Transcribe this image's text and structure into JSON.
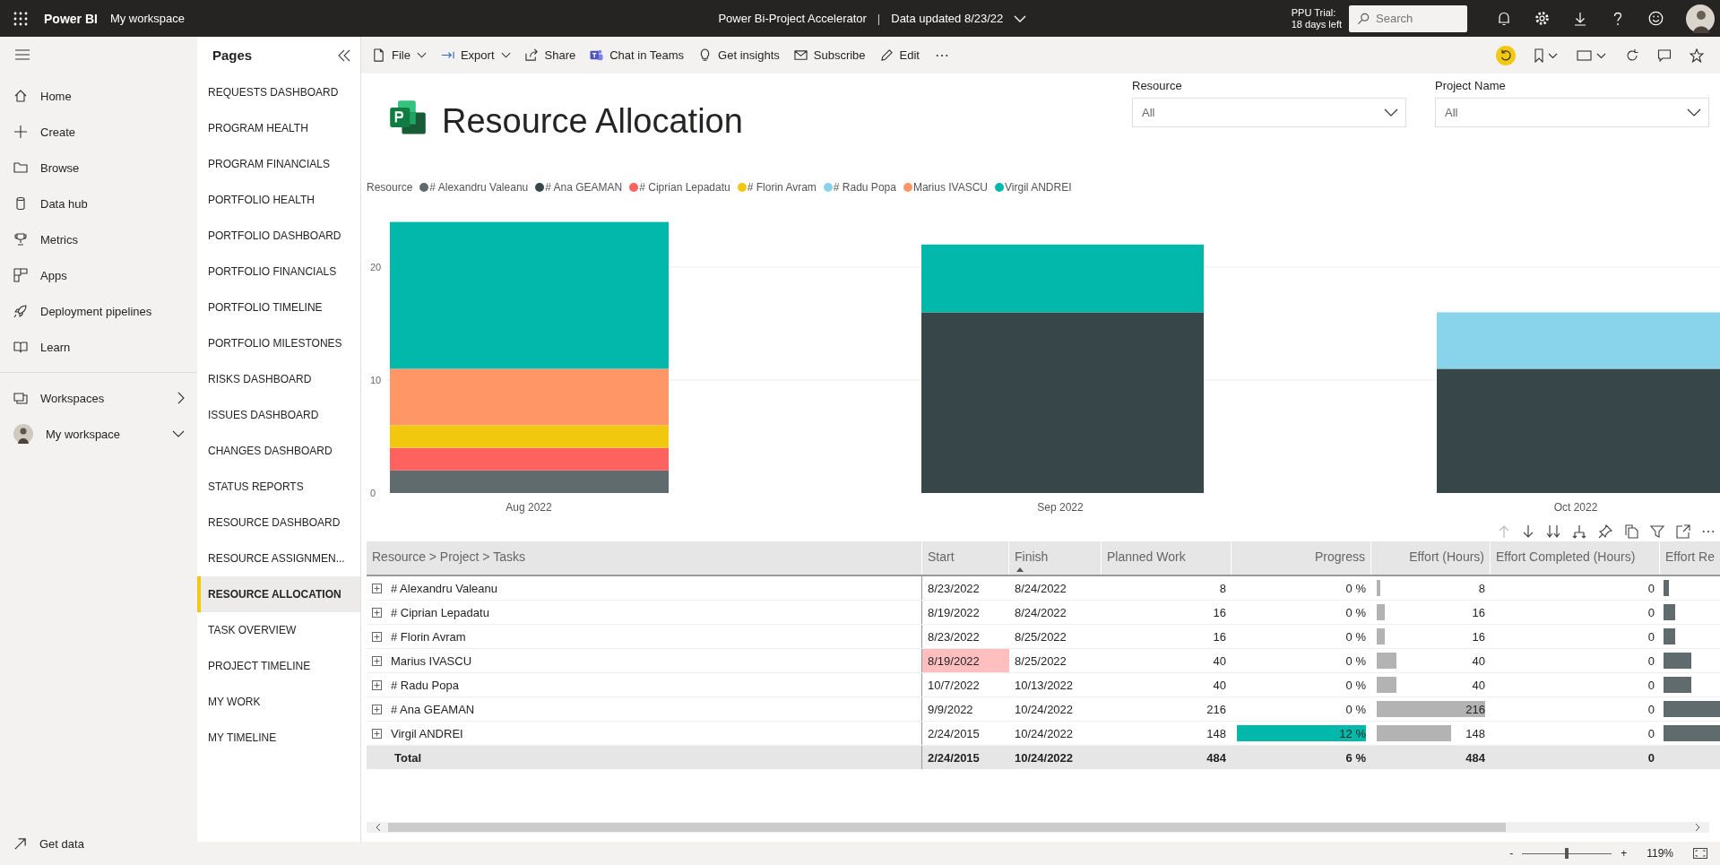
{
  "topbar": {
    "app_name": "Power BI",
    "workspace": "My workspace",
    "report_name": "Power Bi-Project Accelerator",
    "separator": "|",
    "data_updated": "Data updated 8/23/22",
    "trial_line1": "PPU Trial:",
    "trial_line2": "18 days left",
    "search": {
      "placeholder": "Search"
    }
  },
  "nav": {
    "items": [
      {
        "label": "Home"
      },
      {
        "label": "Create"
      },
      {
        "label": "Browse"
      },
      {
        "label": "Data hub"
      },
      {
        "label": "Metrics"
      },
      {
        "label": "Apps"
      },
      {
        "label": "Deployment pipelines"
      },
      {
        "label": "Learn"
      }
    ],
    "workspaces": "Workspaces",
    "my_workspace": "My workspace",
    "get_data": "Get data"
  },
  "pages": {
    "title": "Pages",
    "items": [
      {
        "label": "REQUESTS DASHBOARD",
        "selected": false
      },
      {
        "label": "PROGRAM HEALTH",
        "selected": false
      },
      {
        "label": "PROGRAM FINANCIALS",
        "selected": false
      },
      {
        "label": "PORTFOLIO HEALTH",
        "selected": false
      },
      {
        "label": "PORTFOLIO DASHBOARD",
        "selected": false
      },
      {
        "label": "PORTFOLIO FINANCIALS",
        "selected": false
      },
      {
        "label": "PORTFOLIO TIMELINE",
        "selected": false
      },
      {
        "label": "PORTFOLIO MILESTONES",
        "selected": false
      },
      {
        "label": "RISKS DASHBOARD",
        "selected": false
      },
      {
        "label": "ISSUES DASHBOARD",
        "selected": false
      },
      {
        "label": "CHANGES DASHBOARD",
        "selected": false
      },
      {
        "label": "STATUS REPORTS",
        "selected": false
      },
      {
        "label": "RESOURCE DASHBOARD",
        "selected": false
      },
      {
        "label": "RESOURCE ASSIGNMEN...",
        "selected": false
      },
      {
        "label": "RESOURCE ALLOCATION",
        "selected": true
      },
      {
        "label": "TASK OVERVIEW",
        "selected": false
      },
      {
        "label": "PROJECT TIMELINE",
        "selected": false
      },
      {
        "label": "MY WORK",
        "selected": false
      },
      {
        "label": "MY TIMELINE",
        "selected": false
      }
    ]
  },
  "toolbar": {
    "actions": [
      {
        "label": "File",
        "has_menu": true
      },
      {
        "label": "Export",
        "has_menu": true
      },
      {
        "label": "Share",
        "has_menu": false
      },
      {
        "label": "Chat in Teams",
        "has_menu": false
      },
      {
        "label": "Get insights",
        "has_menu": false
      },
      {
        "label": "Subscribe",
        "has_menu": false
      },
      {
        "label": "Edit",
        "has_menu": false
      }
    ]
  },
  "report": {
    "title": "Resource Allocation",
    "slicers": [
      {
        "label": "Resource",
        "value": "All"
      },
      {
        "label": "Project Name",
        "value": "All"
      }
    ],
    "chart": {
      "legend_title": "Resource",
      "chart_data": {
        "type": "bar",
        "stacked": true,
        "categories": [
          "Aug 2022",
          "Sep 2022",
          "Oct 2022"
        ],
        "legend": "top",
        "ylim": [
          0,
          24
        ],
        "yticks": [
          0,
          10,
          20
        ],
        "series": [
          {
            "name": "# Alexandru Valeanu",
            "color": "#5f6b6d",
            "values": [
              2,
              0,
              0
            ]
          },
          {
            "name": "# Ana GEAMAN",
            "color": "#374649",
            "values": [
              0,
              16,
              11
            ]
          },
          {
            "name": "# Ciprian Lepadatu",
            "color": "#fd625e",
            "values": [
              2,
              0,
              0
            ]
          },
          {
            "name": "# Florin Avram",
            "color": "#f2c80f",
            "values": [
              2,
              0,
              0
            ]
          },
          {
            "name": "# Radu Popa",
            "color": "#8ad4eb",
            "values": [
              0,
              0,
              5
            ]
          },
          {
            "name": "Marius IVASCU",
            "color": "#fe9666",
            "values": [
              5,
              0,
              0
            ]
          },
          {
            "name": "Virgil ANDREI",
            "color": "#01b8aa",
            "values": [
              13,
              6,
              0
            ]
          }
        ]
      }
    }
  },
  "table": {
    "columns": [
      {
        "label": "Resource > Project > Tasks",
        "sorted": false
      },
      {
        "label": "Start",
        "sorted": false
      },
      {
        "label": "Finish",
        "sorted": true
      },
      {
        "label": "Planned Work",
        "sorted": false
      },
      {
        "label": "Progress",
        "sorted": false
      },
      {
        "label": "Effort (Hours)",
        "sorted": false
      },
      {
        "label": "Effort Completed (Hours)",
        "sorted": false
      },
      {
        "label": "Effort Re",
        "sorted": false
      }
    ],
    "rows": [
      {
        "name": "# Alexandru Valeanu",
        "start": "8/23/2022",
        "start_flagged": false,
        "finish": "8/24/2022",
        "planned_work": "8",
        "progress": "0 %",
        "effort": "8",
        "effort_completed": "0"
      },
      {
        "name": "# Ciprian Lepadatu",
        "start": "8/19/2022",
        "start_flagged": false,
        "finish": "8/24/2022",
        "planned_work": "16",
        "progress": "0 %",
        "effort": "16",
        "effort_completed": "0"
      },
      {
        "name": "# Florin Avram",
        "start": "8/23/2022",
        "start_flagged": false,
        "finish": "8/25/2022",
        "planned_work": "16",
        "progress": "0 %",
        "effort": "16",
        "effort_completed": "0"
      },
      {
        "name": "Marius IVASCU",
        "start": "8/19/2022",
        "start_flagged": true,
        "finish": "8/25/2022",
        "planned_work": "40",
        "progress": "0 %",
        "effort": "40",
        "effort_completed": "0"
      },
      {
        "name": "# Radu Popa",
        "start": "10/7/2022",
        "start_flagged": false,
        "finish": "10/13/2022",
        "planned_work": "40",
        "progress": "0 %",
        "effort": "40",
        "effort_completed": "0"
      },
      {
        "name": "# Ana GEAMAN",
        "start": "9/9/2022",
        "start_flagged": false,
        "finish": "10/24/2022",
        "planned_work": "216",
        "progress": "0 %",
        "effort": "216",
        "effort_completed": "0"
      },
      {
        "name": "Virgil ANDREI",
        "start": "2/24/2015",
        "start_flagged": false,
        "finish": "10/24/2022",
        "planned_work": "148",
        "progress": "12 %",
        "effort": "148",
        "effort_completed": "0"
      }
    ],
    "total": {
      "name": "Total",
      "start": "2/24/2015",
      "finish": "10/24/2022",
      "planned_work": "484",
      "progress": "6 %",
      "effort": "484",
      "effort_completed": "0"
    }
  },
  "status_bar": {
    "minus": "-",
    "plus": "+",
    "zoom": {
      "level": 0.5
    },
    "zoom_value": "119%"
  }
}
